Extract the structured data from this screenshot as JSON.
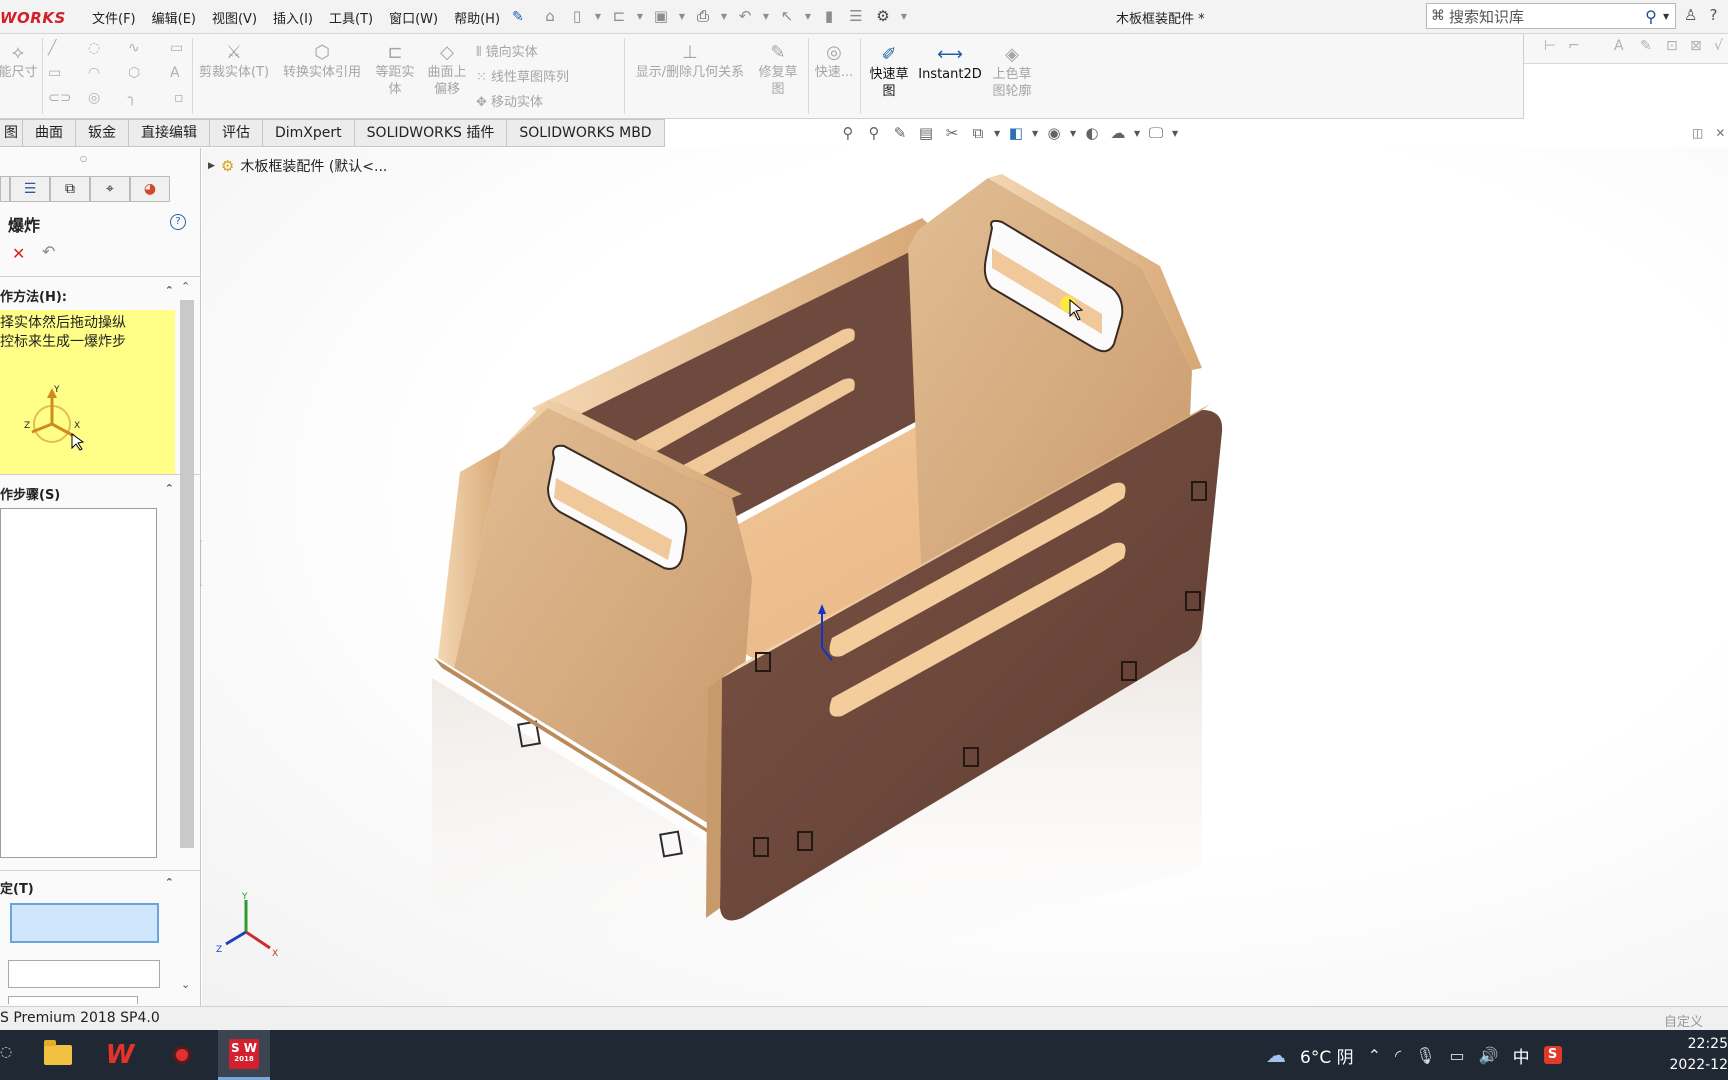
{
  "app": {
    "logo": "WORKS",
    "document_title": "木板框装配件 *"
  },
  "menu": [
    "文件(F)",
    "编辑(E)",
    "视图(V)",
    "插入(I)",
    "工具(T)",
    "窗口(W)",
    "帮助(H)"
  ],
  "search": {
    "placeholder": "搜索知识库"
  },
  "ribbon": {
    "smart_dim": "能尺寸",
    "trim": "剪裁实体(T)",
    "convert": "转换实体引用",
    "offset_l1": "等距实",
    "offset_l2": "体",
    "surface_offset_l1": "曲面上",
    "surface_offset_l2": "偏移",
    "mirror": "镜向实体",
    "linear_pattern": "线性草图阵列",
    "move": "移动实体",
    "display_relations": "显示/删除几何关系",
    "repair_l1": "修复草",
    "repair_l2": "图",
    "quick_snap": "快速...",
    "rapid_sketch_l1": "快速草",
    "rapid_sketch_l2": "图",
    "instant2d": "Instant2D",
    "shaded_l1": "上色草",
    "shaded_l2": "图轮廓"
  },
  "tabs": [
    "图",
    "曲面",
    "钣金",
    "直接编辑",
    "评估",
    "DimXpert",
    "SOLIDWORKS 插件",
    "SOLIDWORKS MBD"
  ],
  "panel": {
    "title": "爆炸",
    "help": "?",
    "method_header": "作方法(H):",
    "method_text": "择实体然后拖动操纵\n控标来生成一爆炸步",
    "steps_header": "作步骤(S)",
    "settings_header": "定(T)",
    "triad_labels": {
      "y": "Y",
      "z": "Z",
      "x": "X"
    }
  },
  "tree": {
    "node": "木板框装配件  (默认<..."
  },
  "status": {
    "text": "S Premium 2018 SP4.0",
    "right": "自定义"
  },
  "taskbar": {
    "wps": "W",
    "sw_line1": "S W",
    "sw_line2": "2018",
    "weather": "6°C  阴",
    "ime": "中",
    "ime_s": "S",
    "time": "22:25",
    "date": "2022-12"
  },
  "colors": {
    "logo_red": "#d21f2a",
    "wood_light": "#d8ad82",
    "wood_dark": "#6a4639",
    "selection_blue": "#cfe6fb",
    "help_yellow": "#ffff88"
  }
}
